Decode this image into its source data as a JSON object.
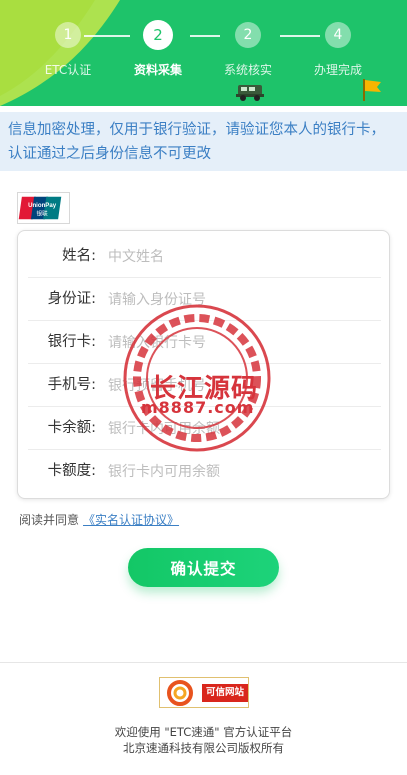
{
  "header": {
    "steps": [
      {
        "number": "1",
        "label": "ETC认证",
        "state": "done"
      },
      {
        "number": "2",
        "label": "资料采集",
        "state": "active"
      },
      {
        "number": "2",
        "label": "系统核实",
        "state": "pending"
      },
      {
        "number": "4",
        "label": "办理完成",
        "state": "pending"
      }
    ],
    "icons": [
      "truck-icon",
      "flag-icon"
    ]
  },
  "notice": {
    "text": "信息加密处理，仅用于银行验证，请验证您本人的银行卡，认证通过之后身份信息不可更改"
  },
  "bank_logo": {
    "brand_text": "UnionPay 银联"
  },
  "form": {
    "fields": [
      {
        "label": "姓名:",
        "placeholder": "中文姓名",
        "value": ""
      },
      {
        "label": "身份证:",
        "placeholder": "请输入身份证号",
        "value": ""
      },
      {
        "label": "银行卡:",
        "placeholder": "请输入银行卡号",
        "value": ""
      },
      {
        "label": "手机号:",
        "placeholder": "银行预留手机号",
        "value": ""
      },
      {
        "label": "卡余额:",
        "placeholder": "银行卡内可用余额",
        "value": ""
      },
      {
        "label": "卡额度:",
        "placeholder": "银行卡内可用余额",
        "value": ""
      }
    ]
  },
  "agreement": {
    "prefix": "阅读并同意",
    "link": "《实名认证协议》"
  },
  "submit": {
    "label": "确认提交"
  },
  "watermark": {
    "title": "长江源码",
    "subtitle": "m8887.com"
  },
  "footer": {
    "badge": "可信网站",
    "line1": "欢迎使用 \"ETC速通\" 官方认证平台",
    "line2": "北京速通科技有限公司版权所有"
  },
  "colors": {
    "primary": "#1ec36a",
    "notice_bg": "#e5eff9",
    "notice_text": "#3b7fc4",
    "watermark": "#d6343c"
  }
}
